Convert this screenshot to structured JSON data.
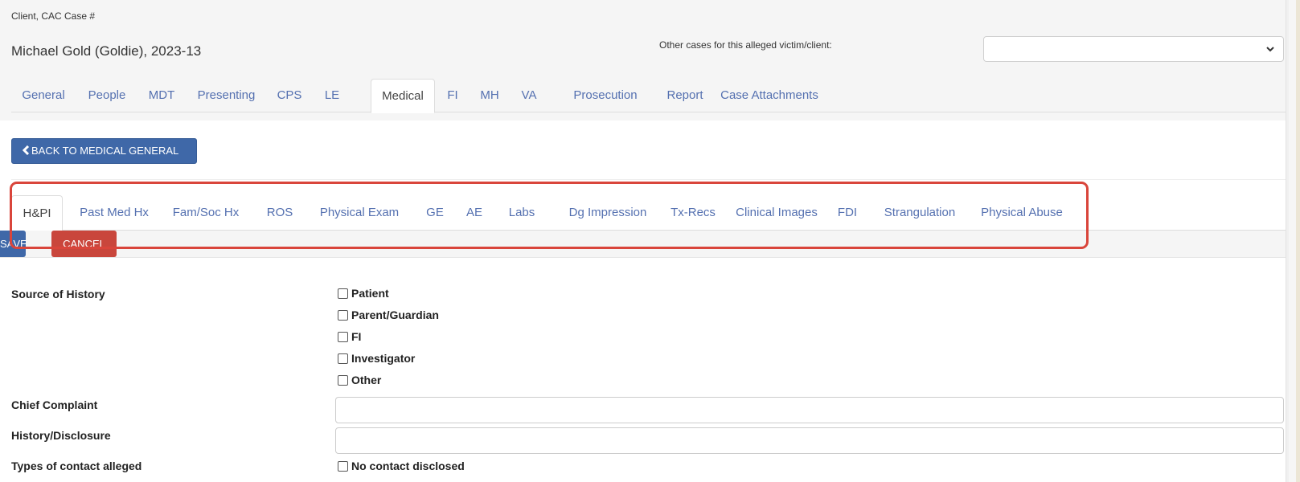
{
  "header": {
    "client_caption": "Client, CAC Case #",
    "client_name": "Michael Gold (Goldie), 2023-13",
    "other_cases_label": "Other cases for this alleged victim/client:",
    "other_cases_value": ""
  },
  "top_tabs": [
    {
      "label": "General"
    },
    {
      "label": "People"
    },
    {
      "label": "MDT"
    },
    {
      "label": "Presenting"
    },
    {
      "label": "CPS"
    },
    {
      "label": "LE"
    },
    {
      "label": "Medical",
      "active": true
    },
    {
      "label": "FI"
    },
    {
      "label": "MH"
    },
    {
      "label": "VA"
    },
    {
      "label": "Prosecution"
    },
    {
      "label": "Report"
    },
    {
      "label": "Case Attachments"
    }
  ],
  "back_button": {
    "label": "BACK TO MEDICAL GENERAL",
    "icon": "chevron-left-icon"
  },
  "sub_tabs": [
    {
      "label": "H&PI",
      "active": true
    },
    {
      "label": "Past Med Hx"
    },
    {
      "label": "Fam/Soc Hx"
    },
    {
      "label": "ROS"
    },
    {
      "label": "Physical Exam"
    },
    {
      "label": "GE"
    },
    {
      "label": "AE"
    },
    {
      "label": "Labs"
    },
    {
      "label": "Dg Impression"
    },
    {
      "label": "Tx-Recs"
    },
    {
      "label": "Clinical Images"
    },
    {
      "label": "FDI"
    },
    {
      "label": "Strangulation"
    },
    {
      "label": "Physical Abuse"
    }
  ],
  "actions": {
    "save_label": "SAVE",
    "cancel_label": "CANCEL"
  },
  "form": {
    "source_of_history": {
      "label": "Source of History",
      "options": [
        {
          "label": "Patient",
          "checked": false
        },
        {
          "label": "Parent/Guardian",
          "checked": false
        },
        {
          "label": "FI",
          "checked": false
        },
        {
          "label": "Investigator",
          "checked": false
        },
        {
          "label": "Other",
          "checked": false
        }
      ]
    },
    "chief_complaint": {
      "label": "Chief Complaint",
      "value": ""
    },
    "history_disclosure": {
      "label": "History/Disclosure",
      "value": ""
    },
    "types_of_contact": {
      "label": "Types of contact alleged",
      "options": [
        {
          "label": "No contact disclosed",
          "checked": false
        }
      ]
    }
  },
  "colors": {
    "primary": "#3f68a8",
    "danger": "#c9463c",
    "link": "#5470b0",
    "highlight": "#d9453b"
  }
}
